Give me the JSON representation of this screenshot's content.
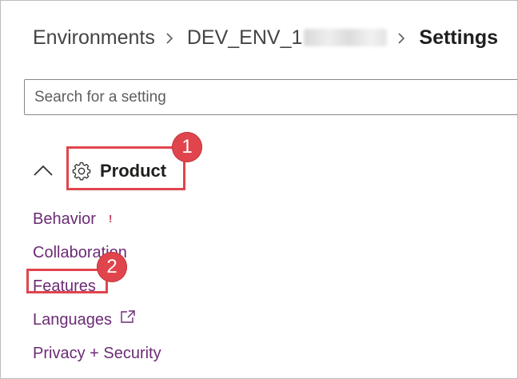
{
  "breadcrumb": {
    "items": [
      "Environments",
      "DEV_ENV_1"
    ],
    "current": "Settings"
  },
  "search": {
    "placeholder": "Search for a setting",
    "value": ""
  },
  "group": {
    "title": "Product",
    "icon": "gear-icon",
    "expanded": true
  },
  "nav_items": [
    {
      "label": "Behavior",
      "badge": "!"
    },
    {
      "label": "Collaboration"
    },
    {
      "label": "Features"
    },
    {
      "label": "Languages",
      "icon": "external-link-icon"
    },
    {
      "label": "Privacy + Security"
    }
  ],
  "annotations": {
    "step_1": "1",
    "step_2": "2"
  },
  "colors": {
    "link": "#6b2c74",
    "highlight": "#e0454d",
    "alert": "#c4314b"
  }
}
